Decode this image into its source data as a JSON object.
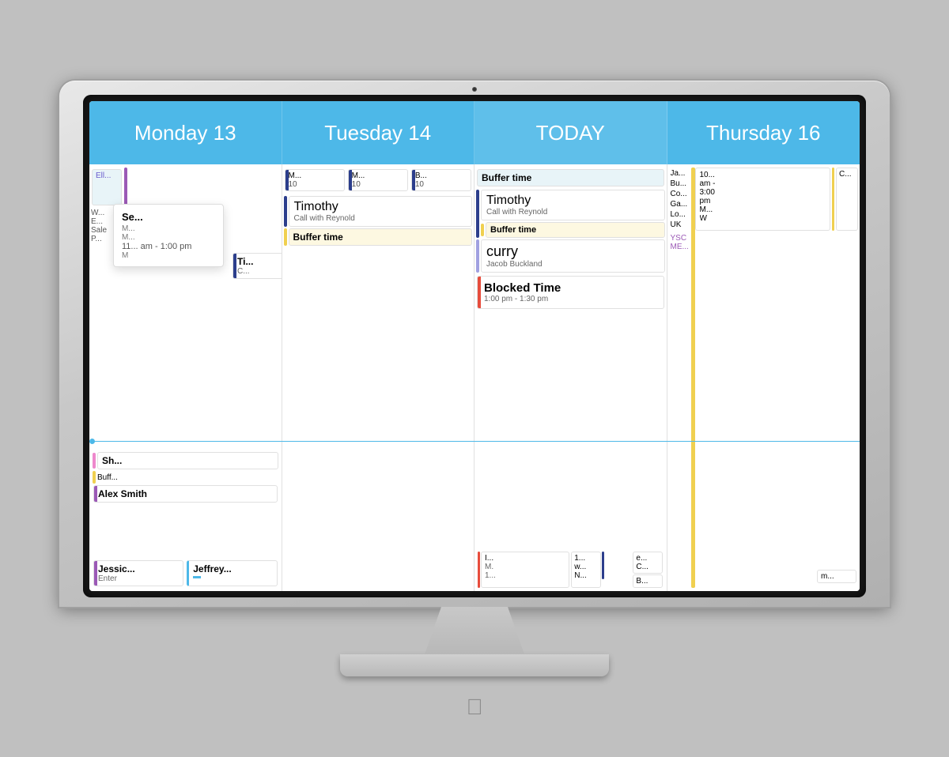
{
  "header": {
    "days": [
      {
        "label": "Monday 13",
        "type": "normal"
      },
      {
        "label": "Tuesday 14",
        "type": "normal"
      },
      {
        "label": "TODAY",
        "type": "today"
      },
      {
        "label": "Thursday 16",
        "type": "normal"
      }
    ]
  },
  "colors": {
    "header_bg": "#4db8e8",
    "header_text": "#ffffff",
    "stripe_blue": "#2c3e8c",
    "stripe_yellow": "#f0d050",
    "stripe_purple": "#9b59b6",
    "stripe_red": "#e74c3c",
    "stripe_lavender": "#a0a0e0",
    "time_line": "#4db8e8"
  },
  "monday_events": {
    "top": [
      {
        "title": "Ell...",
        "sub": ""
      },
      {
        "title": "W...",
        "sub": ""
      },
      {
        "title": "E...",
        "sub": ""
      },
      {
        "title": "Sale",
        "sub": ""
      },
      {
        "title": "P...",
        "sub": ""
      }
    ],
    "popup": {
      "title": "Se... M... M...",
      "time": "11... am - 1:00 pm",
      "sub": "M"
    },
    "midcards": [
      {
        "title": "Ti...",
        "stripe": "blue"
      }
    ],
    "lower": [
      {
        "title": "Sh...",
        "sub": ""
      },
      {
        "title": "Buff...",
        "sub": ""
      },
      {
        "title": "Alex Smith",
        "sub": ""
      }
    ],
    "bottom": [
      {
        "title": "Jessic...",
        "sub": "Enter"
      },
      {
        "title": "Jeffrey...",
        "sub": ""
      }
    ]
  },
  "tuesday_events": {
    "top": [
      {
        "title": "M...",
        "stripe": "blue"
      },
      {
        "title": "M...",
        "stripe": "blue"
      },
      {
        "title": "B...",
        "stripe": "blue"
      }
    ],
    "nums": [
      "10",
      "10",
      "10"
    ],
    "main": {
      "title": "Timothy",
      "sub": "Call with Reynold"
    },
    "buffer": "Buffer time",
    "bottom": []
  },
  "today_events": {
    "top": {
      "title": "Buffer time"
    },
    "card1": {
      "title": "Timothy",
      "sub": "Call with Reynold",
      "stripe": "blue"
    },
    "buffer1": "Buffer time",
    "card2": {
      "title": "curry",
      "sub": "Jacob Buckland",
      "stripe": "lavender"
    },
    "blocked": {
      "title": "Blocked Time",
      "time": "1:00 pm - 1:30 pm",
      "stripe": "red"
    },
    "bottom_left": {
      "title": "I...",
      "sub": "M. 1..."
    },
    "bottom_right": {
      "title": "1... w... N..."
    },
    "bottom_extra": [
      {
        "title": "e... C..."
      },
      {
        "title": "B..."
      }
    ]
  },
  "thursday_events": {
    "side_labels": [
      "Ja...",
      "Bu...",
      "Co...",
      "Ga...",
      "Lo...",
      "UK"
    ],
    "ysc": "YSC",
    "me": "ME...",
    "top_right": {
      "title": "10... am - 3:00 pm",
      "sub": "M... W"
    },
    "c_label": "C...",
    "bottom": [
      {
        "title": "m..."
      }
    ],
    "yellow_bars": true
  }
}
